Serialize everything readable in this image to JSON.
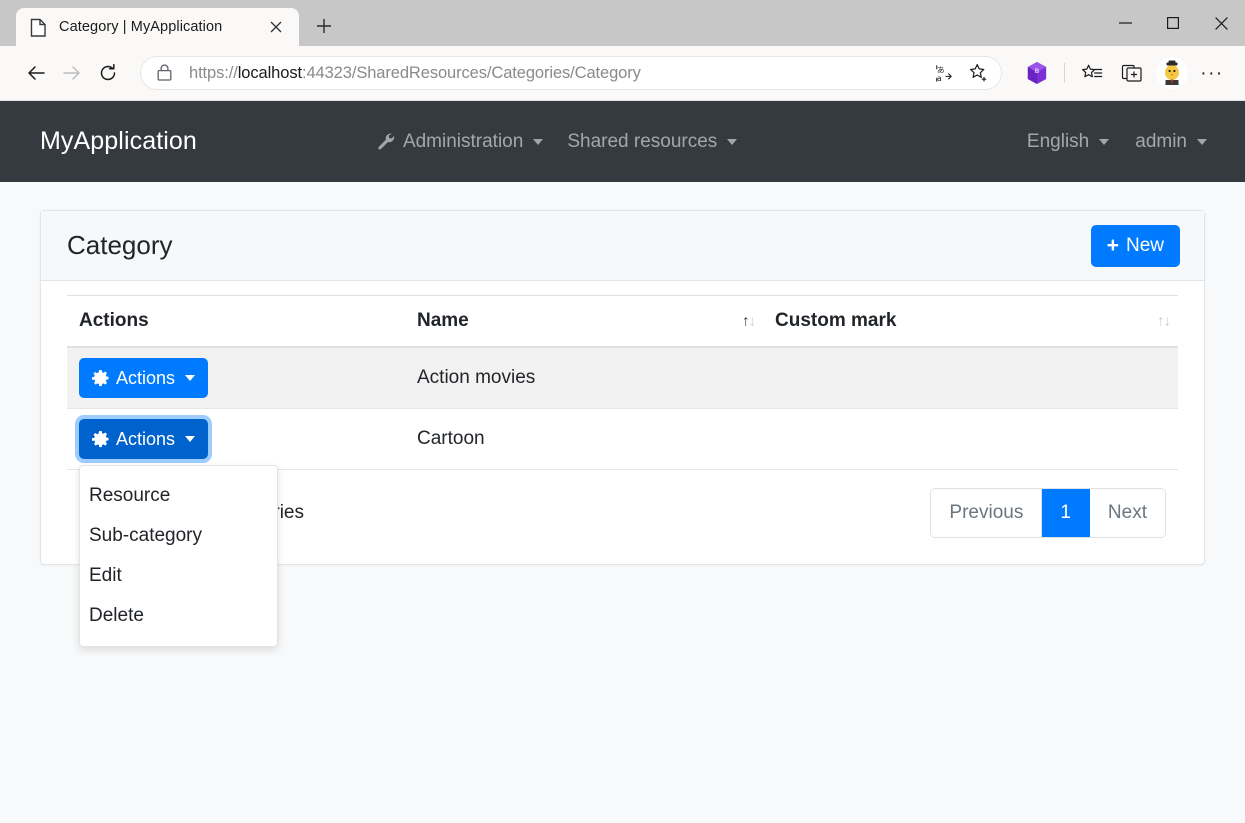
{
  "browser": {
    "tab": {
      "title": "Category | MyApplication",
      "favicon_icon": "page-icon",
      "close_icon": "×"
    },
    "new_tab_label": "+",
    "window_controls": {
      "minimize": "minimize-icon",
      "maximize": "maximize-icon",
      "close": "close-icon"
    },
    "nav": {
      "back": "back-arrow-icon",
      "forward": "forward-arrow-icon",
      "reload": "reload-icon"
    },
    "address": {
      "lock_icon": "lock-icon",
      "url_prefix": "https://",
      "url_host": "localhost",
      "url_suffix": ":44323/SharedResources/Categories/Category",
      "full_url": "https://localhost:44323/SharedResources/Categories/Category",
      "translate_icon": "translate-icon",
      "favorite_icon": "star-add-icon"
    },
    "toolbar_buttons": [
      {
        "name": "extension-hexagon-icon"
      },
      {
        "name": "collections-star-list-icon"
      },
      {
        "name": "split-screen-icon"
      },
      {
        "name": "profile-avatar"
      },
      {
        "name": "settings-more-icon",
        "label": "···"
      }
    ]
  },
  "navbar": {
    "brand": "MyApplication",
    "links": [
      {
        "label": "Administration",
        "icon": "wrench-icon",
        "has_caret": true
      },
      {
        "label": "Shared resources",
        "icon": null,
        "has_caret": true
      }
    ],
    "right": [
      {
        "label": "English",
        "has_caret": true
      },
      {
        "label": "admin",
        "has_caret": true
      }
    ]
  },
  "card": {
    "title": "Category",
    "new_button": {
      "label": "New",
      "icon": "plus-icon"
    }
  },
  "table": {
    "columns": [
      {
        "label": "Actions",
        "sortable": false
      },
      {
        "label": "Name",
        "sortable": true,
        "sort_state": "asc"
      },
      {
        "label": "Custom mark",
        "sortable": true,
        "sort_state": "none"
      }
    ],
    "sort_glyph": {
      "up": "↑",
      "down": "↓"
    },
    "rows": [
      {
        "actions_label": "Actions",
        "actions_icon": "gear-icon",
        "name": "Action movies",
        "custom_mark": "",
        "menu_open": false
      },
      {
        "actions_label": "Actions",
        "actions_icon": "gear-icon",
        "name": "Cartoon",
        "custom_mark": "",
        "menu_open": true
      }
    ],
    "dropdown": {
      "items": [
        {
          "label": "Resource"
        },
        {
          "label": "Sub-category"
        },
        {
          "label": "Edit"
        },
        {
          "label": "Delete"
        }
      ]
    },
    "footer": {
      "showing_info": "Showing 1 to 2 of 2 entries",
      "pagination": [
        {
          "label": "Previous",
          "state": "disabled"
        },
        {
          "label": "1",
          "state": "active"
        },
        {
          "label": "Next",
          "state": "disabled"
        }
      ]
    }
  },
  "colors": {
    "primary": "#007bff",
    "primary_active": "#0062cc",
    "navbar_bg": "#343a40",
    "page_bg": "#f8f9fa",
    "row_stripe": "#f2f2f2"
  }
}
